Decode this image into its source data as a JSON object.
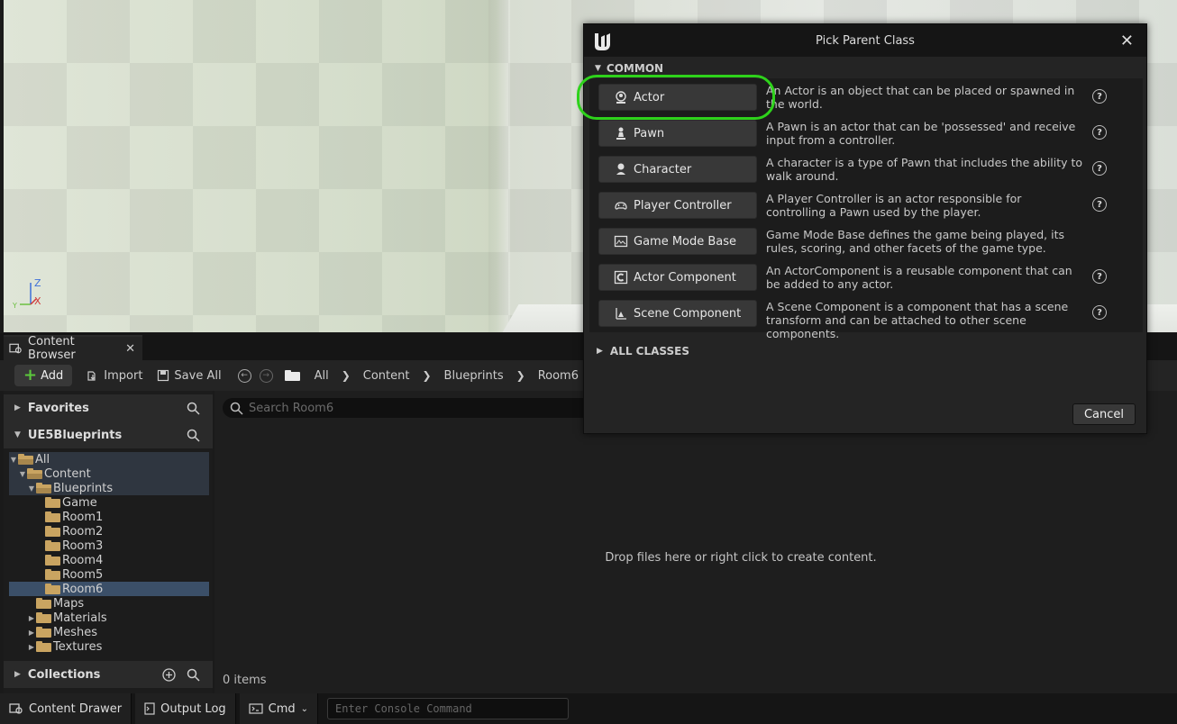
{
  "viewport": {
    "axis_z": "Z",
    "axis_x": "X",
    "axis_y": "Y"
  },
  "content_browser": {
    "tab_title": "Content Browser",
    "toolbar": {
      "add_label": "Add",
      "import_label": "Import",
      "save_all_label": "Save All",
      "breadcrumbs": [
        "All",
        "Content",
        "Blueprints",
        "Room6"
      ]
    },
    "favorites_label": "Favorites",
    "project_label": "UE5Blueprints",
    "collections_label": "Collections",
    "tree": [
      {
        "label": "All",
        "depth": 0,
        "expanded": true,
        "open": true
      },
      {
        "label": "Content",
        "depth": 1,
        "expanded": true,
        "open": true
      },
      {
        "label": "Blueprints",
        "depth": 2,
        "expanded": true,
        "open": true
      },
      {
        "label": "Game",
        "depth": 3
      },
      {
        "label": "Room1",
        "depth": 3
      },
      {
        "label": "Room2",
        "depth": 3
      },
      {
        "label": "Room3",
        "depth": 3
      },
      {
        "label": "Room4",
        "depth": 3
      },
      {
        "label": "Room5",
        "depth": 3
      },
      {
        "label": "Room6",
        "depth": 3,
        "selected": true
      },
      {
        "label": "Maps",
        "depth": 2
      },
      {
        "label": "Materials",
        "depth": 2,
        "collapsed": true
      },
      {
        "label": "Meshes",
        "depth": 2,
        "collapsed": true
      },
      {
        "label": "Textures",
        "depth": 2,
        "collapsed": true
      }
    ],
    "search_placeholder": "Search Room6",
    "drop_text": "Drop files here or right click to create content.",
    "items_count": "0 items"
  },
  "statusbar": {
    "content_drawer": "Content Drawer",
    "output_log": "Output Log",
    "cmd": "Cmd",
    "console_placeholder": "Enter Console Command"
  },
  "dialog": {
    "title": "Pick Parent Class",
    "common_label": "COMMON",
    "all_classes_label": "ALL CLASSES",
    "cancel_label": "Cancel",
    "classes": [
      {
        "name": "Actor",
        "icon": "actor-icon",
        "desc": "An Actor is an object that can be placed or spawned in the world.",
        "help": true
      },
      {
        "name": "Pawn",
        "icon": "pawn-icon",
        "desc": "A Pawn is an actor that can be 'possessed' and receive input from a controller.",
        "help": true
      },
      {
        "name": "Character",
        "icon": "character-icon",
        "desc": "A character is a type of Pawn that includes the ability to walk around.",
        "help": true
      },
      {
        "name": "Player Controller",
        "icon": "gamepad-icon",
        "desc": "A Player Controller is an actor responsible for controlling a Pawn used by the player.",
        "help": true
      },
      {
        "name": "Game Mode Base",
        "icon": "game-mode-icon",
        "desc": "Game Mode Base defines the game being played, its rules, scoring, and other facets of the game type.",
        "help": false
      },
      {
        "name": "Actor Component",
        "icon": "actor-component-icon",
        "desc": "An ActorComponent is a reusable component that can be added to any actor.",
        "help": true
      },
      {
        "name": "Scene Component",
        "icon": "scene-component-icon",
        "desc": "A Scene Component is a component that has a scene transform and can be attached to other scene components.",
        "help": true
      }
    ]
  },
  "colors": {
    "highlight": "#2ed21b",
    "folder": "#c9a461",
    "selection": "#3b4f68",
    "add_plus": "#5cc93c"
  }
}
